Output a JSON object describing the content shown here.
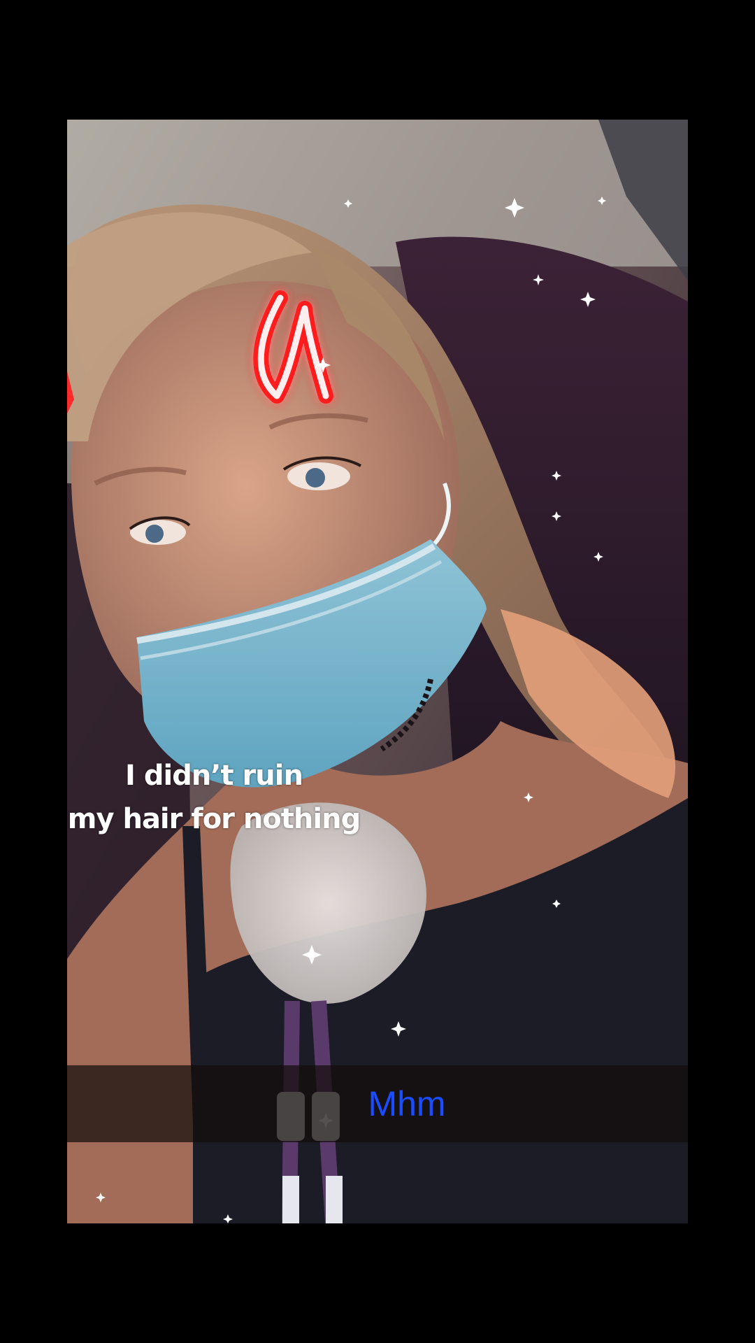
{
  "story": {
    "overlay_lines": [
      "I didn’t ruin",
      "my hair for nothing"
    ],
    "caption": "Mhm"
  },
  "colors": {
    "background": "#000000",
    "overlay_text": "#ffffff",
    "caption_text": "#1a4dff",
    "caption_bar": "#140e0c",
    "horn_glow": "#ff1e1e"
  },
  "icons": [
    "devil-horn-sticker",
    "sparkle-icon"
  ]
}
